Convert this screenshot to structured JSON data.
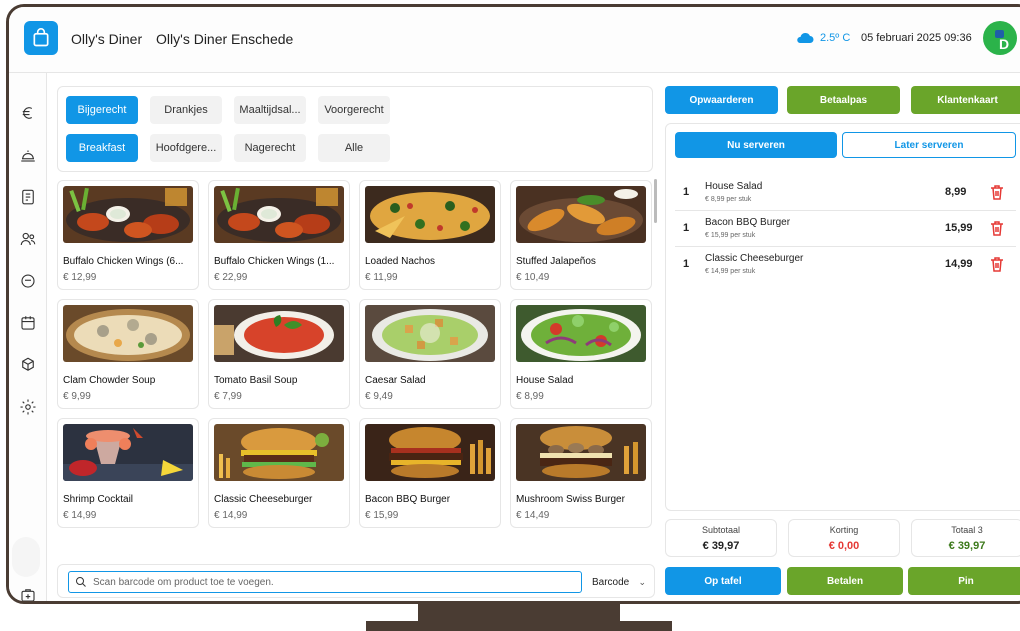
{
  "header": {
    "app_name": "Olly's Diner",
    "location": "Olly's Diner Enschede",
    "temperature": "2.5º C",
    "datetime": "05 februari 2025  09:36",
    "user_initial": "D"
  },
  "sidebar": {
    "items": [
      {
        "icon": "euro-icon"
      },
      {
        "icon": "cloche-icon"
      },
      {
        "icon": "menu-icon"
      },
      {
        "icon": "users-icon"
      },
      {
        "icon": "chat-icon"
      },
      {
        "icon": "calendar-icon"
      },
      {
        "icon": "boxes-icon"
      },
      {
        "icon": "settings-icon"
      },
      {
        "icon": "add-package-icon"
      }
    ]
  },
  "categories": [
    {
      "label": "Bijgerecht",
      "active": true
    },
    {
      "label": "Drankjes",
      "active": false
    },
    {
      "label": "Maaltijdsal...",
      "active": false
    },
    {
      "label": "Voorgerecht",
      "active": false
    },
    {
      "label": "Breakfast",
      "active": true
    },
    {
      "label": "Hoofdgere...",
      "active": false
    },
    {
      "label": "Nagerecht",
      "active": false
    },
    {
      "label": "Alle",
      "active": false
    }
  ],
  "products": [
    {
      "name": "Buffalo Chicken Wings (6...",
      "price": "€ 12,99",
      "img": "wings"
    },
    {
      "name": "Buffalo Chicken Wings (1...",
      "price": "€ 22,99",
      "img": "wings"
    },
    {
      "name": "Loaded Nachos",
      "price": "€ 11,99",
      "img": "nachos"
    },
    {
      "name": "Stuffed Jalapeños",
      "price": "€ 10,49",
      "img": "jalapenos"
    },
    {
      "name": "Clam Chowder Soup",
      "price": "€ 9,99",
      "img": "chowder"
    },
    {
      "name": "Tomato Basil Soup",
      "price": "€ 7,99",
      "img": "tomatosoup"
    },
    {
      "name": "Caesar Salad",
      "price": "€ 9,49",
      "img": "caesar"
    },
    {
      "name": "House Salad",
      "price": "€ 8,99",
      "img": "housesalad"
    },
    {
      "name": "Shrimp Cocktail",
      "price": "€ 14,99",
      "img": "shrimp"
    },
    {
      "name": "Classic Cheeseburger",
      "price": "€ 14,99",
      "img": "cheeseburger"
    },
    {
      "name": "Bacon BBQ Burger",
      "price": "€ 15,99",
      "img": "bbqburger"
    },
    {
      "name": "Mushroom Swiss Burger",
      "price": "€ 14,49",
      "img": "mushroomburger"
    }
  ],
  "scan": {
    "placeholder": "Scan barcode om product toe te voegen.",
    "mode": "Barcode"
  },
  "actions_top": {
    "opwaarderen": "Opwaarderen",
    "betaalpas": "Betaalpas",
    "klantenkaart": "Klantenkaart"
  },
  "order": {
    "tab_now": "Nu serveren",
    "tab_later": "Later serveren",
    "items": [
      {
        "qty": "1",
        "name": "House Salad",
        "unit": "€ 8,99 per stuk",
        "total": "8,99"
      },
      {
        "qty": "1",
        "name": "Bacon BBQ Burger",
        "unit": "€ 15,99 per stuk",
        "total": "15,99"
      },
      {
        "qty": "1",
        "name": "Classic Cheeseburger",
        "unit": "€ 14,99 per stuk",
        "total": "14,99"
      }
    ]
  },
  "summary": {
    "subtotal_label": "Subtotaal",
    "subtotal": "€ 39,97",
    "discount_label": "Korting",
    "discount": "€ 0,00",
    "total_label": "Totaal 3",
    "total": "€ 39,97"
  },
  "actions_bottom": {
    "op_tafel": "Op tafel",
    "betalen": "Betalen",
    "pin": "Pin"
  },
  "colors": {
    "accent_blue": "#1196e6",
    "accent_green": "#6aa52a",
    "discount_red": "#e53935",
    "total_green": "#3d7a1c",
    "frame": "#4a3c33"
  }
}
